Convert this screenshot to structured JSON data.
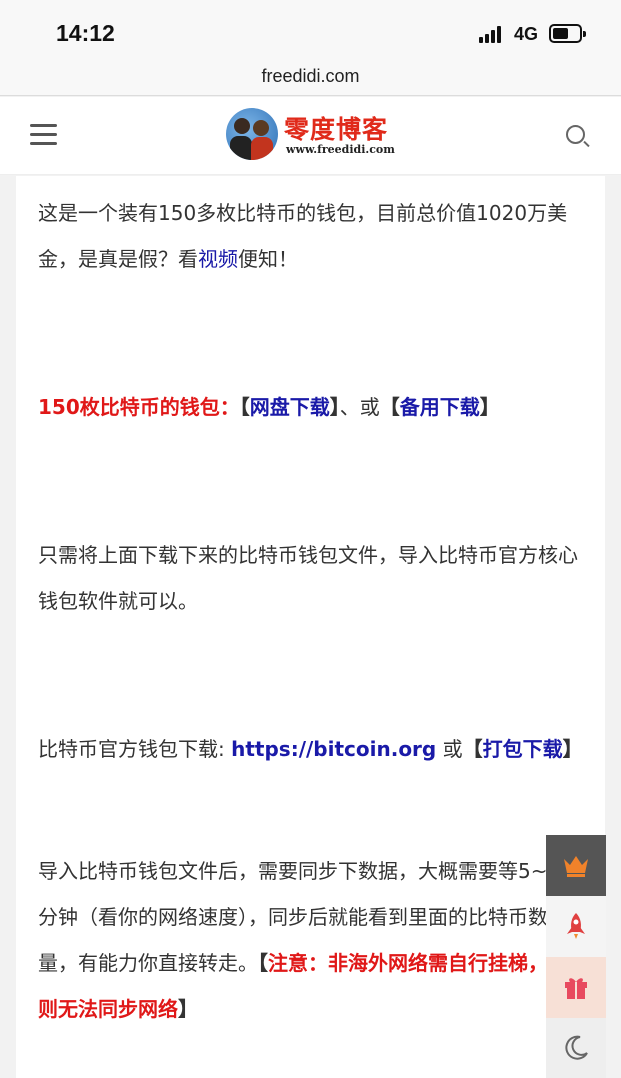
{
  "status_bar": {
    "time": "14:12",
    "network": "4G",
    "battery_level": 0.6
  },
  "browser": {
    "url": "freedidi.com"
  },
  "header": {
    "site_title": "零度博客",
    "site_url": "www.freedidi.com",
    "menu_icon": "hamburger-menu-icon",
    "search_icon": "search-icon"
  },
  "article": {
    "p1": {
      "text_before": "这是一个装有150多枚比特币的钱包，目前总价值1020万美金，是真是假？看",
      "link": "视频",
      "text_after": "便知！"
    },
    "p2": {
      "label": "150枚比特币的钱包：",
      "bracket_open_1": "【",
      "link1": "网盘下载",
      "bracket_close_1": "】",
      "separator": "、或",
      "bracket_open_2": "【",
      "link2": "备用下载",
      "bracket_close_2": "】"
    },
    "p3": {
      "text": "只需将上面下载下来的比特币钱包文件，导入比特币官方核心钱包软件就可以。"
    },
    "p4": {
      "label": "比特币官方钱包下载: ",
      "link1": "https://bitcoin.org",
      "separator": " 或",
      "bracket_open": "【",
      "link2": "打包下载",
      "bracket_close": "】"
    },
    "p5": {
      "text": "导入比特币钱包文件后，需要同步下数据，大概需要等5~10分钟（看你的网络速度），同步后就能看到里面的比特币数量，有能力你直接转走。",
      "bracket_open": "【",
      "note": "注意：非海外网络需自行挂梯，否则无法同步网络",
      "bracket_close": "】"
    }
  },
  "side_tools": [
    {
      "icon": "crown-icon"
    },
    {
      "icon": "rocket-icon"
    },
    {
      "icon": "gift-icon"
    },
    {
      "icon": "moon-icon"
    }
  ],
  "colors": {
    "link_blue": "#1a1aa8",
    "accent_red": "#e01818",
    "logo_red": "#e02a1a",
    "crown_orange": "#f0822a",
    "rocket_red": "#e04040"
  }
}
